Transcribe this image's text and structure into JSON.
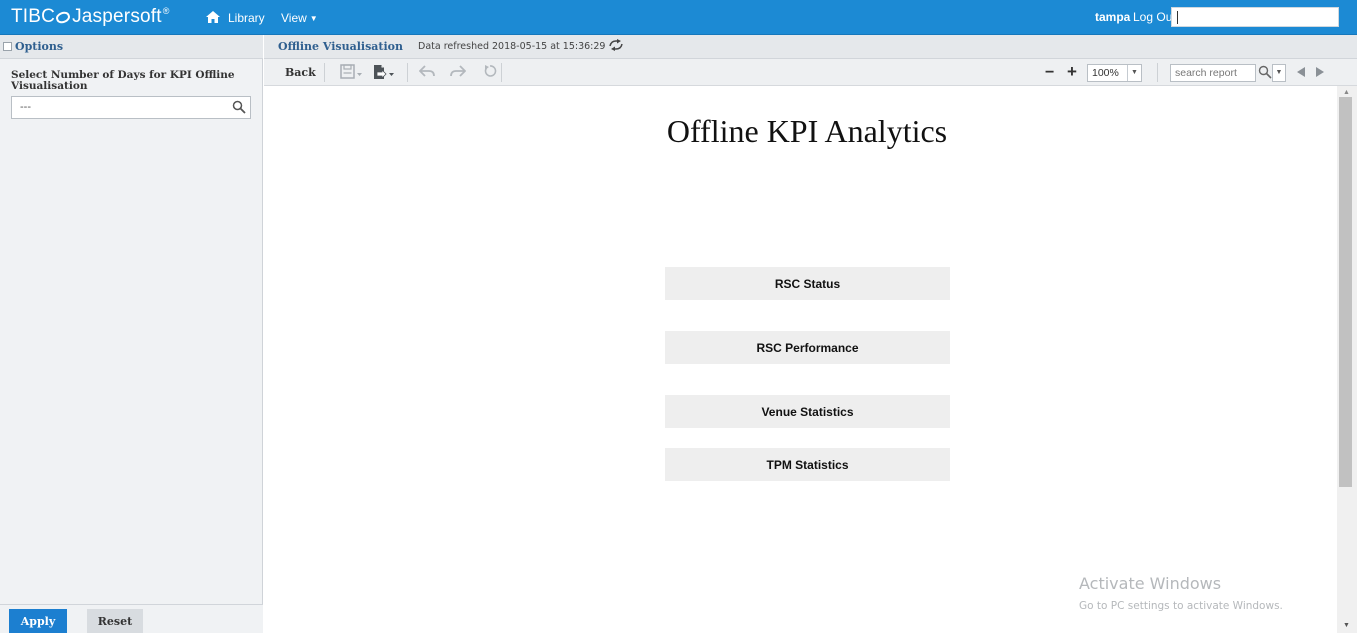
{
  "topbar": {
    "brand_tibco": "TIBC",
    "brand_jaspersoft": "Jaspersoft",
    "brand_tm": "®",
    "nav_library": "Library",
    "nav_view": "View",
    "user_name": "tampa",
    "logout_label": "Log Out",
    "search_value": "",
    "accent_color": "#1c8ad4"
  },
  "options_panel": {
    "title": "Options",
    "param_label": "Select Number of Days for KPI Offline Visualisation",
    "param_value": "---",
    "apply_label": "Apply",
    "reset_label": "Reset"
  },
  "report": {
    "tab_title": "Offline Visualisation",
    "data_refreshed": "Data refreshed 2018-05-15 at 15:36:29",
    "toolbar": {
      "back_label": "Back",
      "zoom_value": "100%",
      "search_placeholder": "search report"
    },
    "heading": "Offline KPI Analytics",
    "links": [
      {
        "label": "RSC Status"
      },
      {
        "label": "RSC Performance"
      },
      {
        "label": "Venue Statistics"
      },
      {
        "label": "TPM Statistics"
      }
    ]
  },
  "watermark": {
    "title": "Activate Windows",
    "subtitle": "Go to PC settings to activate Windows."
  }
}
